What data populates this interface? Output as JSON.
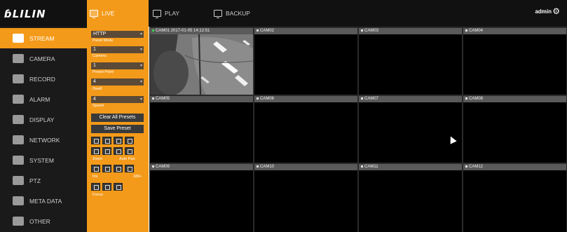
{
  "brand": {
    "logo": "LILIN"
  },
  "top_tabs": [
    {
      "label": "LIVE",
      "icon": "monitor-icon",
      "active": true
    },
    {
      "label": "PLAY",
      "icon": "monitor-icon",
      "active": false
    },
    {
      "label": "BACKUP",
      "icon": "monitor-icon",
      "active": false
    }
  ],
  "user": {
    "name": "admin",
    "settings_icon": "gear-icon"
  },
  "sidebar": {
    "items": [
      {
        "label": "STREAM",
        "icon": "play-icon",
        "active": true
      },
      {
        "label": "CAMERA",
        "icon": "camera-icon"
      },
      {
        "label": "RECORD",
        "icon": "record-icon"
      },
      {
        "label": "ALARM",
        "icon": "alarm-icon"
      },
      {
        "label": "DISPLAY",
        "icon": "display-icon"
      },
      {
        "label": "NETWORK",
        "icon": "network-icon"
      },
      {
        "label": "SYSTEM",
        "icon": "system-icon"
      },
      {
        "label": "PTZ",
        "icon": "ptz-icon"
      },
      {
        "label": "META DATA",
        "icon": "metadata-icon"
      },
      {
        "label": "OTHER",
        "icon": "other-icon"
      }
    ]
  },
  "panel": {
    "panel_mode": {
      "value": "HTTP",
      "label": "Panel Mode"
    },
    "camera": {
      "value": "1",
      "label": "Camera"
    },
    "preset_point": {
      "value": "1",
      "label": "Preset Point"
    },
    "dwell": {
      "value": "4",
      "label": "Dwell"
    },
    "speed": {
      "value": "4",
      "label": "Speed"
    },
    "clear_all_presets": "Clear All Presets",
    "save_preset": "Save Preset",
    "zoom_label": "Zoom",
    "auto_pan_label": "Auto Pan",
    "iris_label": "Iris",
    "flip_label": "180+",
    "focus_label": "Focus"
  },
  "cameras": [
    {
      "title": "CAM01 2017-01-05 14:12:51",
      "live": true
    },
    {
      "title": "CAM02",
      "live": false
    },
    {
      "title": "CAM03",
      "live": false
    },
    {
      "title": "CAM04",
      "live": false
    },
    {
      "title": "CAM05",
      "live": false
    },
    {
      "title": "CAM06",
      "live": false
    },
    {
      "title": "CAM07",
      "live": false
    },
    {
      "title": "CAM08",
      "live": false
    },
    {
      "title": "CAM09",
      "live": false
    },
    {
      "title": "CAM10",
      "live": false
    },
    {
      "title": "CAM11",
      "live": false
    },
    {
      "title": "CAM12",
      "live": false
    }
  ],
  "colors": {
    "accent": "#f39a1a",
    "background": "#111111",
    "live_indicator": "#3cd04a"
  }
}
